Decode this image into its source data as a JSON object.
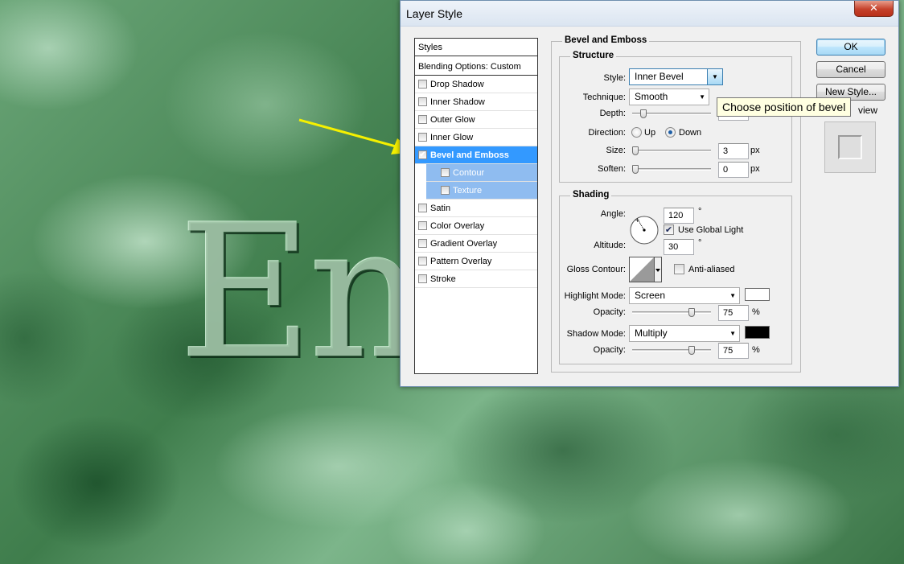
{
  "canvas": {
    "embossed_text": "Emb"
  },
  "dialog": {
    "title": "Layer Style",
    "close_label": "✕",
    "styles_list": {
      "header": "Styles",
      "blending_options": "Blending Options: Custom",
      "items": [
        {
          "label": "Drop Shadow",
          "checked": false
        },
        {
          "label": "Inner Shadow",
          "checked": false
        },
        {
          "label": "Outer Glow",
          "checked": false
        },
        {
          "label": "Inner Glow",
          "checked": false
        },
        {
          "label": "Bevel and Emboss",
          "checked": true,
          "selected": true
        },
        {
          "label": "Contour",
          "checked": false,
          "sub": true
        },
        {
          "label": "Texture",
          "checked": false,
          "sub": true
        },
        {
          "label": "Satin",
          "checked": false
        },
        {
          "label": "Color Overlay",
          "checked": false
        },
        {
          "label": "Gradient Overlay",
          "checked": false
        },
        {
          "label": "Pattern Overlay",
          "checked": false
        },
        {
          "label": "Stroke",
          "checked": false
        }
      ],
      "check_glyph": "✔"
    },
    "bevel": {
      "section_title": "Bevel and Emboss",
      "structure_title": "Structure",
      "style_label": "Style:",
      "style_value": "Inner Bevel",
      "technique_label": "Technique:",
      "technique_value": "Smooth",
      "depth_label": "Depth:",
      "depth_value": "",
      "direction_label": "Direction:",
      "up_label": "Up",
      "down_label": "Down",
      "direction_selected": "Down",
      "size_label": "Size:",
      "size_value": "3",
      "soften_label": "Soften:",
      "soften_value": "0",
      "unit_px": "px"
    },
    "shading": {
      "title": "Shading",
      "angle_label": "Angle:",
      "angle_value": "120",
      "degree": "°",
      "global_light_label": "Use Global Light",
      "global_light_checked": true,
      "altitude_label": "Altitude:",
      "altitude_value": "30",
      "gloss_contour_label": "Gloss Contour:",
      "anti_aliased_label": "Anti-aliased",
      "highlight_mode_label": "Highlight Mode:",
      "highlight_mode_value": "Screen",
      "highlight_color": "#ffffff",
      "highlight_opacity_label": "Opacity:",
      "highlight_opacity_value": "75",
      "shadow_mode_label": "Shadow Mode:",
      "shadow_mode_value": "Multiply",
      "shadow_color": "#000000",
      "shadow_opacity_label": "Opacity:",
      "shadow_opacity_value": "75",
      "percent": "%"
    },
    "buttons": {
      "ok": "OK",
      "cancel": "Cancel",
      "new_style": "New Style...",
      "preview_partial": "view"
    },
    "tooltip": "Choose position of bevel"
  },
  "colors": {
    "selected_row": "#3399ff",
    "sub_row": "#8fbcf0",
    "arrow": "#f5f000"
  }
}
